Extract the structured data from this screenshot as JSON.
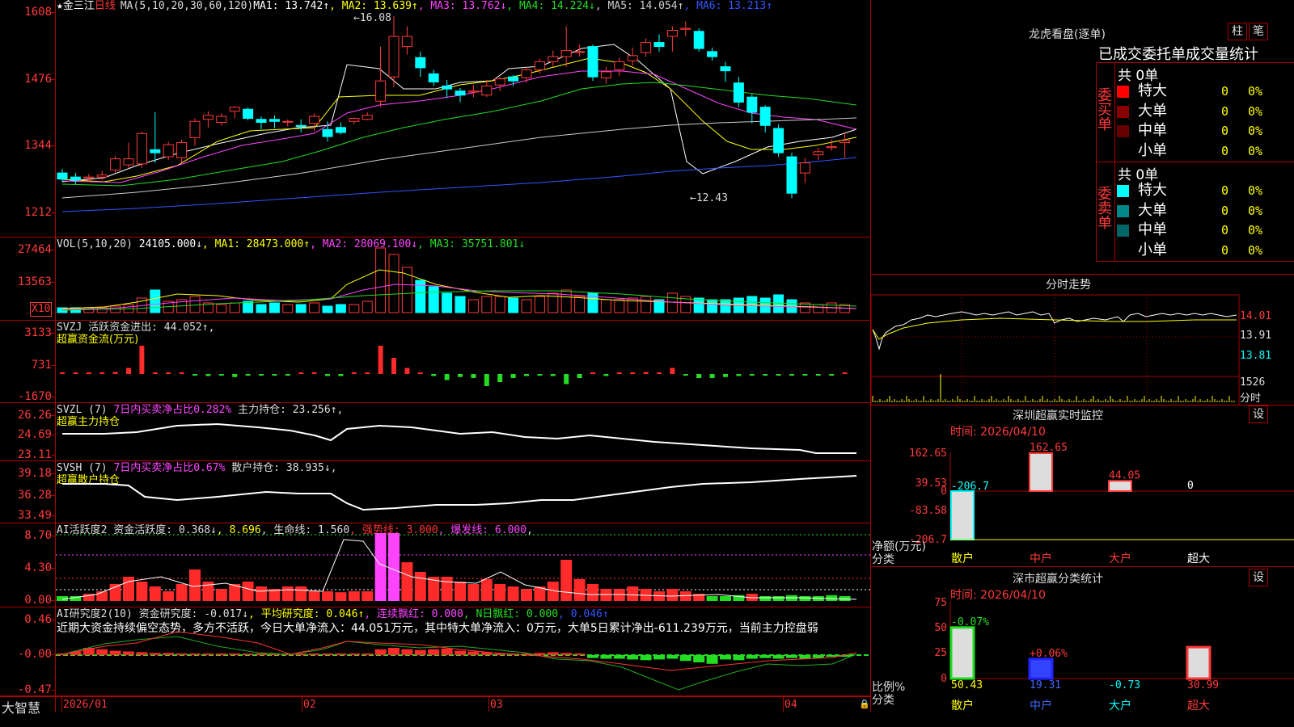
{
  "main": {
    "star": "★",
    "name": "金三江",
    "period": "日线",
    "ma": [
      {
        "label": "MA(5,10,20,30,60,120)",
        "color": "#dddddd"
      },
      {
        "label": "MA1: 13.742↑",
        "color": "#ffffff"
      },
      {
        "label": ", MA2: 13.639↑",
        "color": "#ffff00"
      },
      {
        "label": ", MA3: 13.762↓",
        "color": "#ff44ff"
      },
      {
        "label": ", MA4: 14.224↓",
        "color": "#22dd22"
      },
      {
        "label": ", MA5: 14.054↑",
        "color": "#cccccc"
      },
      {
        "label": ", MA6: 13.213↑",
        "color": "#3355ff"
      }
    ],
    "y_labels": [
      "1608",
      "1476",
      "1344",
      "1212"
    ],
    "high_label": "16.08",
    "low_label": "12.43"
  },
  "vol": {
    "items": [
      {
        "label": "VOL(5,10,20)",
        "color": "#dddddd"
      },
      {
        "label": " 24105.000↓",
        "color": "#ffffff"
      },
      {
        "label": ", MA1: 28473.000↑",
        "color": "#ffff00"
      },
      {
        "label": ", MA2: 28069.100↓",
        "color": "#ff44ff"
      },
      {
        "label": ", MA3: 35751.801↓",
        "color": "#22dd22"
      }
    ],
    "y_labels": [
      "27464",
      "13563"
    ],
    "unit": "X10"
  },
  "svzj": {
    "items": [
      {
        "label": "SVZJ  活跃资金进出: 44.052↑",
        "color": "#dddddd"
      },
      {
        "label": ",",
        "color": "#dddddd"
      }
    ],
    "sub": "超赢资金流(万元)",
    "y_labels": [
      "3133",
      "731",
      "-1670"
    ]
  },
  "svzl": {
    "items": [
      {
        "label": "SVZL (7) ",
        "color": "#dddddd"
      },
      {
        "label": "7日内买卖净占比0.282%",
        "color": "#ff44ff"
      },
      {
        "label": " 主力持仓: 23.256↑",
        "color": "#dddddd"
      },
      {
        "label": ",",
        "color": "#dddddd"
      }
    ],
    "sub": "超赢主力持仓",
    "y_labels": [
      "26.26",
      "24.69",
      "23.11"
    ]
  },
  "svsh": {
    "items": [
      {
        "label": "SVSH (7) ",
        "color": "#dddddd"
      },
      {
        "label": "7日内买卖净占比0.67%",
        "color": "#ff44ff"
      },
      {
        "label": " 散户持仓: 38.935↓",
        "color": "#dddddd"
      },
      {
        "label": ",",
        "color": "#dddddd"
      }
    ],
    "sub": "超赢散户持仓",
    "y_labels": [
      "39.18",
      "36.28",
      "33.49"
    ]
  },
  "ai1": {
    "items": [
      {
        "label": "AI活跃度2 资金活跃度: 0.368↓",
        "color": "#dddddd"
      },
      {
        "label": ", 8.696",
        "color": "#ffff00"
      },
      {
        "label": ", 生命线: 1.560",
        "color": "#dddddd"
      },
      {
        "label": ", 强势线: 3.000",
        "color": "#ff3333"
      },
      {
        "label": ", 爆发线: 6.000",
        "color": "#ff44ff"
      },
      {
        "label": ",",
        "color": "#dddddd"
      }
    ],
    "y_labels": [
      "8.70",
      "4.30",
      "0.00"
    ]
  },
  "ai2": {
    "items": [
      {
        "label": "AI研究度2(10) 资金研究度: -0.017↓",
        "color": "#dddddd"
      },
      {
        "label": ", 平均研究度: 0.046↑",
        "color": "#ffff00"
      },
      {
        "label": ", 连续飘红: 0.000",
        "color": "#ff44ff"
      },
      {
        "label": ", N日飘红: 0.000",
        "color": "#22dd22"
      },
      {
        "label": ", 0.046↑",
        "color": "#3355ff"
      }
    ],
    "comment": "近期大资金持续偏空态势，多方不活跃，今日大单净流入：44.051万元，其中特大单净流入：0万元，大单5日累计净出-611.239万元，当前主力控盘弱",
    "y_labels": [
      "0.46",
      "-0.00",
      "-0.47"
    ]
  },
  "dates": [
    "2026/01",
    "02",
    "03",
    "04"
  ],
  "brand": "大智慧",
  "right": {
    "title": "龙虎看盘(逐单)",
    "btn_pillar": "柱",
    "btn_tick": "笔",
    "header": "已成交委托单成交量统计",
    "buy": {
      "side": "委买单",
      "total": "共 0单",
      "rows": [
        {
          "label": "特大",
          "vol": "0",
          "pct": "0%",
          "color": "#ff0000"
        },
        {
          "label": "大单",
          "vol": "0",
          "pct": "0%",
          "color": "#880000"
        },
        {
          "label": "中单",
          "vol": "0",
          "pct": "0%",
          "color": "#660000"
        },
        {
          "label": "小单",
          "vol": "0",
          "pct": "0%",
          "color": "#000000"
        }
      ]
    },
    "sell": {
      "side": "委卖单",
      "total": "共 0单",
      "rows": [
        {
          "label": "特大",
          "vol": "0",
          "pct": "0%",
          "color": "#00ffff"
        },
        {
          "label": "大单",
          "vol": "0",
          "pct": "0%",
          "color": "#008888"
        },
        {
          "label": "中单",
          "vol": "0",
          "pct": "0%",
          "color": "#006666"
        },
        {
          "label": "小单",
          "vol": "0",
          "pct": "0%",
          "color": "#000000"
        }
      ]
    },
    "intraday": {
      "title": "分时走势",
      "prices": [
        "14.01",
        "13.91",
        "13.81"
      ],
      "vol": "1526",
      "vol_unit": "分时"
    },
    "monitor": {
      "title": "深圳超赢实时监控",
      "btn": "设",
      "time": "时间: 2026/04/10",
      "y_labels": [
        "162.65",
        "39.53",
        "0",
        "-83.58",
        "-206.7"
      ],
      "ylabel": "净额(万元)",
      "xlabel": "分类",
      "categories": [
        "散户",
        "中户",
        "大户",
        "超大"
      ],
      "values": [
        -206.7,
        162.65,
        44.05,
        0
      ],
      "value_labels": [
        "-206.7",
        "162.65",
        "44.05",
        "0"
      ]
    },
    "classify": {
      "title": "深市超赢分类统计",
      "btn": "设",
      "time": "时间: 2026/04/10",
      "y_labels": [
        "75",
        "50",
        "25",
        "0"
      ],
      "ylabel": "比例%",
      "xlabel": "分类",
      "categories": [
        "散户",
        "中户",
        "大户",
        "超大"
      ],
      "values": [
        50.43,
        19.31,
        -0.73,
        30.99
      ],
      "value_labels": [
        "50.43",
        "19.31",
        "-0.73",
        "30.99"
      ],
      "change_labels": [
        "-0.07%",
        "+0.06%",
        "",
        ""
      ]
    }
  }
}
